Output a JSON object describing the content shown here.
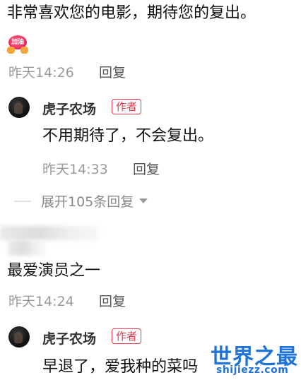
{
  "comments": [
    {
      "text": "非常喜欢您的电影，期待您的复出。",
      "sticker_label": "加油",
      "time": "昨天14:26",
      "reply_label": "回复",
      "replies": [
        {
          "username": "虎子农场",
          "badge": "作者",
          "text": "不用期待了，不会复出。",
          "time": "昨天14:33",
          "reply_label": "回复"
        }
      ],
      "expand_label": "展开105条回复"
    },
    {
      "text": "最爱演员之一",
      "time": "昨天14:24",
      "reply_label": "回复",
      "replies": [
        {
          "username": "虎子农场",
          "badge": "作者",
          "text": "早退了，爱我种的菜吗"
        }
      ]
    }
  ],
  "watermark": {
    "title": "世界之最",
    "url": "shijiezz.com"
  },
  "colors": {
    "author_badge": "#e8344a",
    "watermark": "#1f73d8",
    "meta_gray": "#9a9a9a"
  }
}
